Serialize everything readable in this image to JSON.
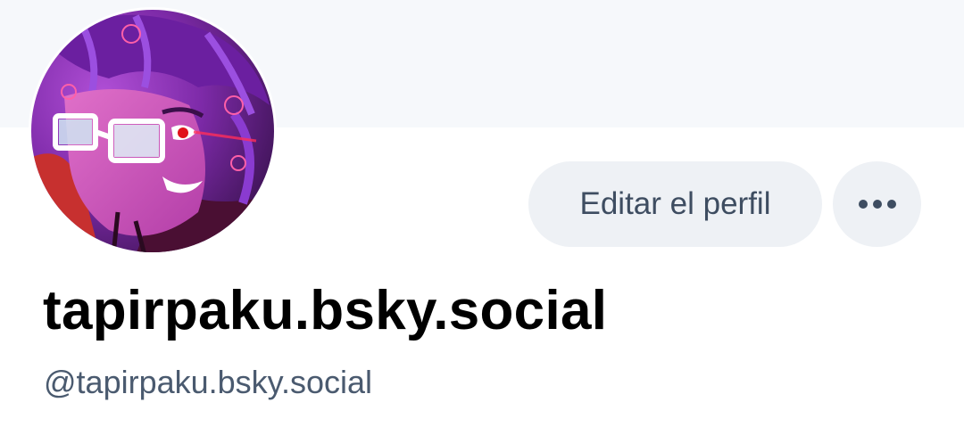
{
  "profile": {
    "display_name": "tapirpaku.bsky.social",
    "handle": "@tapirpaku.bsky.social",
    "avatar_icon": "user-avatar-image"
  },
  "actions": {
    "edit_label": "Editar el perfil",
    "more_icon": "ellipsis-icon"
  },
  "colors": {
    "banner": "#f6f8fb",
    "button_bg": "#eef1f5",
    "button_text": "#3e4d61",
    "handle_text": "#4a5a6f"
  }
}
